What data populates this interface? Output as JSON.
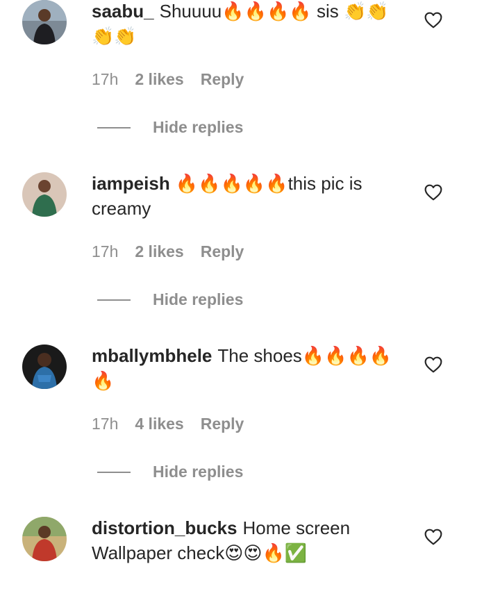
{
  "comments": [
    {
      "username": "saabu_",
      "text": "Shuuuu🔥🔥🔥🔥 sis 👏👏👏👏",
      "time": "17h",
      "likes": "2 likes",
      "reply": "Reply",
      "hide_replies": "Hide replies"
    },
    {
      "username": "iampeish",
      "text": "🔥🔥🔥🔥🔥this pic is creamy",
      "time": "17h",
      "likes": "2 likes",
      "reply": "Reply",
      "hide_replies": "Hide replies"
    },
    {
      "username": "mballymbhele",
      "text": "The shoes🔥🔥🔥🔥🔥",
      "time": "17h",
      "likes": "4 likes",
      "reply": "Reply",
      "hide_replies": "Hide replies"
    },
    {
      "username": "distortion_bucks",
      "text": "Home screen Wallpaper check😍😍🔥✅"
    }
  ],
  "icons": {
    "like": "heart-outline-icon"
  },
  "colors": {
    "text_primary": "#262626",
    "text_secondary": "#8e8e8e",
    "background": "#ffffff"
  }
}
